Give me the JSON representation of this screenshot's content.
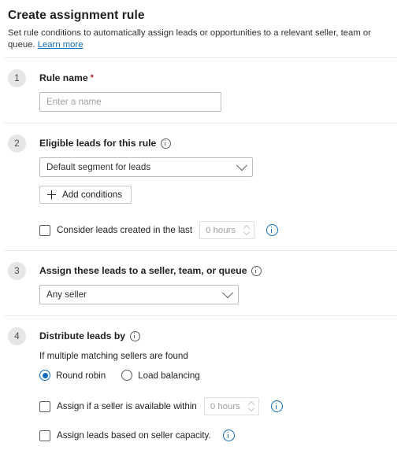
{
  "header": {
    "title": "Create assignment rule",
    "subtitle": "Set rule conditions to automatically assign leads or opportunities to a relevant seller, team or queue.",
    "learn_more": "Learn more",
    "link_color": "#0f6cbd"
  },
  "steps": {
    "one": {
      "number": "1",
      "title": "Rule name",
      "required_marker": "*",
      "input_placeholder": "Enter a name",
      "input_value": ""
    },
    "two": {
      "number": "2",
      "title": "Eligible leads for this rule",
      "info_icon": "info-icon",
      "segment_dropdown_value": "Default segment for leads",
      "add_conditions_label": "Add conditions",
      "add_icon": "plus-icon",
      "consider_checkbox_label": "Consider leads created in the last",
      "consider_checkbox_checked": false,
      "consider_spinner_value": "0 hours"
    },
    "three": {
      "number": "3",
      "title": "Assign these leads to a seller, team, or queue",
      "info_icon": "info-icon",
      "assignee_dropdown_value": "Any seller"
    },
    "four": {
      "number": "4",
      "title": "Distribute leads by",
      "info_icon": "info-icon",
      "helper_text": "If multiple matching sellers are found",
      "radio_options": [
        {
          "label": "Round robin",
          "selected": true
        },
        {
          "label": "Load balancing",
          "selected": false
        }
      ],
      "available_within_label": "Assign if a seller is available within",
      "available_within_checked": false,
      "available_within_spinner_value": "0 hours",
      "capacity_label": "Assign leads based on seller capacity.",
      "capacity_checked": false
    }
  },
  "icons": {
    "chevron_down": "chevron-down-icon",
    "spinner_up": "spinner-up-icon",
    "spinner_down": "spinner-down-icon"
  }
}
